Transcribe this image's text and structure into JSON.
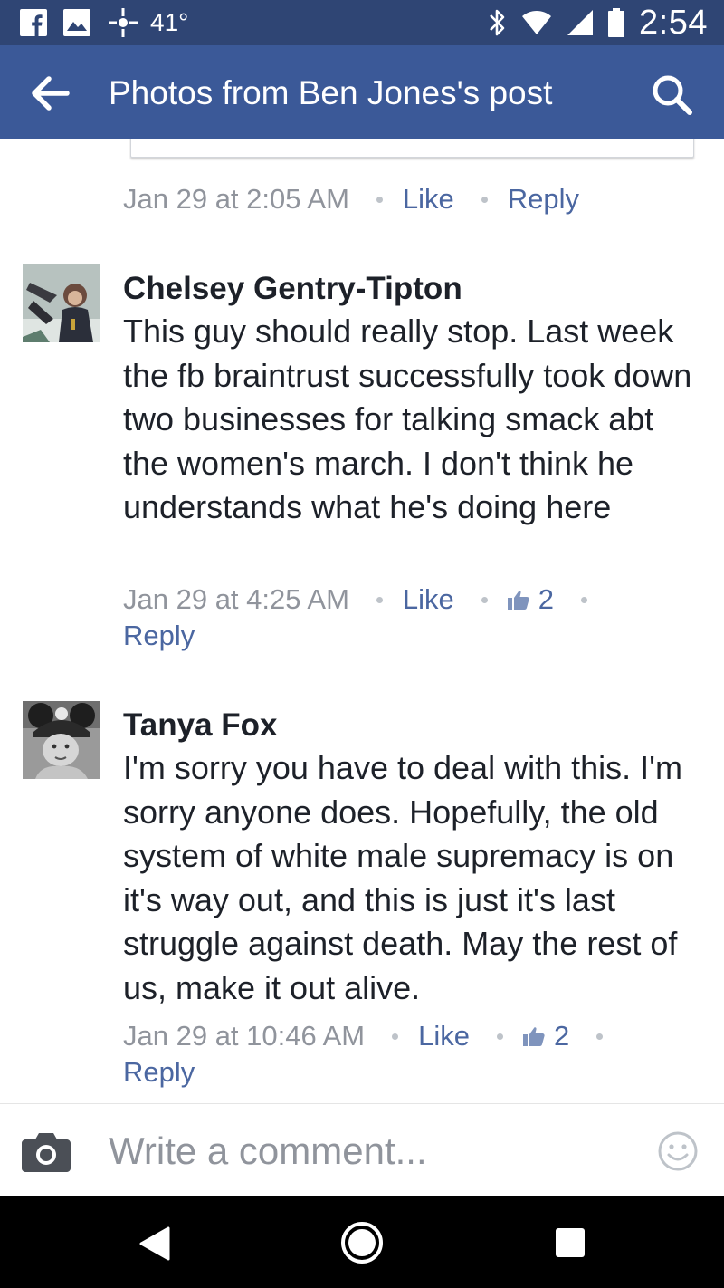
{
  "status_bar": {
    "temperature": "41°",
    "time": "2:54",
    "icons": [
      "facebook-icon",
      "gallery-icon",
      "weather-icon",
      "bluetooth-icon",
      "wifi-icon",
      "signal-icon",
      "battery-icon"
    ]
  },
  "header": {
    "title": "Photos from Ben Jones's post",
    "back_icon": "arrow-left-icon",
    "search_icon": "search-icon"
  },
  "colors": {
    "status_bar": "#2f4574",
    "app_bar": "#3b5998",
    "link": "#4b67a1",
    "meta_text": "#90949c",
    "body_text": "#1d2129"
  },
  "previous_comment": {
    "timestamp": "Jan 29 at 2:05 AM",
    "like_label": "Like",
    "reply_label": "Reply"
  },
  "comments": [
    {
      "author": "Chelsey Gentry-Tipton",
      "text": "This guy should really stop. Last week the fb braintrust successfully took down two businesses for talking smack abt the women's march. I don't think he understands what he's doing here",
      "timestamp": "Jan 29 at 4:25 AM",
      "like_label": "Like",
      "like_count": "2",
      "reply_label": "Reply"
    },
    {
      "author": "Tanya Fox",
      "text": "I'm sorry you have to deal with this. I'm sorry anyone does. Hopefully, the old system of white male supremacy is on it's way out, and this is just it's last struggle against death. May the rest of us, make it out alive.",
      "timestamp": "Jan 29 at 10:46 AM",
      "like_label": "Like",
      "like_count": "2",
      "reply_label": "Reply"
    }
  ],
  "composer": {
    "placeholder": "Write a comment...",
    "camera_icon": "camera-icon",
    "emoji_icon": "smiley-icon"
  },
  "nav_bar": {
    "icons": [
      "nav-back-icon",
      "nav-home-icon",
      "nav-recents-icon"
    ]
  }
}
